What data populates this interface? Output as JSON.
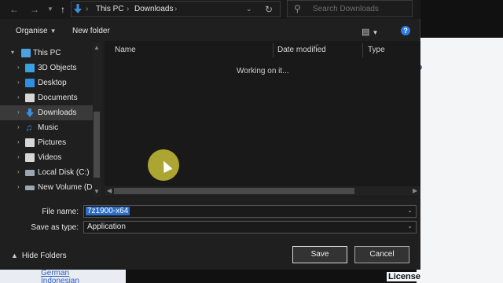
{
  "nav": {
    "back_icon": "back-arrow-icon",
    "forward_icon": "forward-arrow-icon",
    "up_icon": "up-arrow-icon",
    "path": [
      "This PC",
      "Downloads"
    ],
    "search_placeholder": "Search Downloads"
  },
  "toolbar": {
    "organise_label": "Organise",
    "new_folder_label": "New folder"
  },
  "sidebar": {
    "items": [
      {
        "label": "This PC",
        "icon": "computer-icon",
        "color": "#4aa3df"
      },
      {
        "label": "3D Objects",
        "icon": "cube-icon",
        "color": "#3aa0e0"
      },
      {
        "label": "Desktop",
        "icon": "desktop-icon",
        "color": "#2f8fe0"
      },
      {
        "label": "Documents",
        "icon": "documents-icon",
        "color": "#d7d7d7"
      },
      {
        "label": "Downloads",
        "icon": "download-icon",
        "color": "#3a8fe0"
      },
      {
        "label": "Music",
        "icon": "music-icon",
        "color": "#3a8fe0"
      },
      {
        "label": "Pictures",
        "icon": "pictures-icon",
        "color": "#d7d7d7"
      },
      {
        "label": "Videos",
        "icon": "videos-icon",
        "color": "#d7d7d7"
      },
      {
        "label": "Local Disk (C:)",
        "icon": "drive-icon",
        "color": "#9aa7b4"
      },
      {
        "label": "New Volume (D:",
        "icon": "drive-icon",
        "color": "#9aa7b4"
      }
    ]
  },
  "main": {
    "columns": [
      "Name",
      "Date modified",
      "Type"
    ],
    "status_text": "Working on it..."
  },
  "form": {
    "file_name_label": "File name:",
    "file_name_value": "7z1900-x64",
    "save_type_label": "Save as type:",
    "save_type_value": "Application"
  },
  "footer": {
    "hide_folders_label": "Hide Folders",
    "save_label": "Save",
    "cancel_label": "Cancel"
  },
  "background": {
    "license_text": "License",
    "languages": [
      "German",
      "Indonesian"
    ]
  }
}
